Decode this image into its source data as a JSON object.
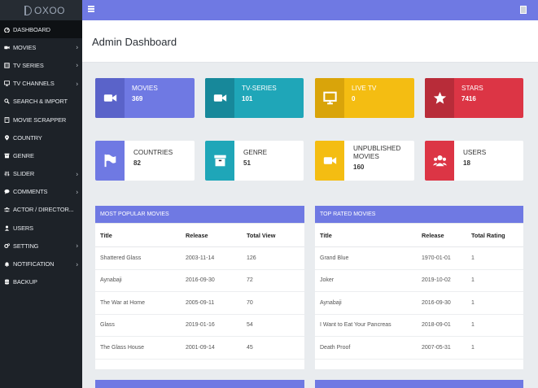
{
  "app": {
    "logo_text": "OXOO"
  },
  "sidebar": {
    "items": [
      {
        "label": "DASHBOARD",
        "icon": "dashboard-icon",
        "caret": false,
        "active": true
      },
      {
        "label": "MOVIES",
        "icon": "video-camera-icon",
        "caret": true,
        "active": false
      },
      {
        "label": "TV SERIES",
        "icon": "film-icon",
        "caret": true,
        "active": false
      },
      {
        "label": "TV CHANNELS",
        "icon": "monitor-icon",
        "caret": true,
        "active": false
      },
      {
        "label": "SEARCH & IMPORT",
        "icon": "search-icon",
        "caret": false,
        "active": false
      },
      {
        "label": "MOVIE SCRAPPER",
        "icon": "document-icon",
        "caret": false,
        "active": false
      },
      {
        "label": "COUNTRY",
        "icon": "map-marker-icon",
        "caret": false,
        "active": false
      },
      {
        "label": "GENRE",
        "icon": "archive-icon",
        "caret": false,
        "active": false
      },
      {
        "label": "SLIDER",
        "icon": "sliders-icon",
        "caret": true,
        "active": false
      },
      {
        "label": "COMMENTS",
        "icon": "comment-icon",
        "caret": true,
        "active": false
      },
      {
        "label": "ACTOR / DIRECTOR...",
        "icon": "users-group-icon",
        "caret": false,
        "active": false
      },
      {
        "label": "USERS",
        "icon": "user-icon",
        "caret": false,
        "active": false
      },
      {
        "label": "SETTING",
        "icon": "gears-icon",
        "caret": true,
        "active": false
      },
      {
        "label": "NOTIFICATION",
        "icon": "bell-icon",
        "caret": true,
        "active": false
      },
      {
        "label": "BACKUP",
        "icon": "database-icon",
        "caret": false,
        "active": false
      }
    ]
  },
  "header": {
    "title": "Admin Dashboard"
  },
  "stats_row1": [
    {
      "label": "MOVIES",
      "value": "369",
      "icon": "video-camera-icon",
      "color": "#6f79e3",
      "icon_bg": "#5a63c9"
    },
    {
      "label": "TV-SERIES",
      "value": "101",
      "icon": "video-camera-icon",
      "color": "#1fa6b8",
      "icon_bg": "#17889a"
    },
    {
      "label": "LIVE TV",
      "value": "0",
      "icon": "monitor-icon",
      "color": "#f4bd12",
      "icon_bg": "#d9a40a"
    },
    {
      "label": "STARS",
      "value": "7416",
      "icon": "star-icon",
      "color": "#dc3545",
      "icon_bg": "#b82c39"
    }
  ],
  "stats_row2": [
    {
      "label": "COUNTRIES",
      "value": "82",
      "icon": "flag-icon",
      "color": "#6f79e3"
    },
    {
      "label": "GENRE",
      "value": "51",
      "icon": "archive-icon",
      "color": "#1fa6b8"
    },
    {
      "label": "UNPUBLISHED MOVIES",
      "value": "160",
      "icon": "video-camera-icon",
      "color": "#f4bd12"
    },
    {
      "label": "USERS",
      "value": "18",
      "icon": "users-group-icon",
      "color": "#dc3545"
    }
  ],
  "popular": {
    "title": "MOST POPULAR MOVIES",
    "columns": [
      "Title",
      "Release",
      "Total View"
    ],
    "rows": [
      [
        "Shattered Glass",
        "2003-11-14",
        "126"
      ],
      [
        "Aynabaji",
        "2016-09-30",
        "72"
      ],
      [
        "The War at Home",
        "2005-09-11",
        "70"
      ],
      [
        "Glass",
        "2019-01-16",
        "54"
      ],
      [
        "The Glass House",
        "2001-09-14",
        "45"
      ]
    ]
  },
  "top_rated": {
    "title": "TOP RATED MOVIES",
    "columns": [
      "Title",
      "Release",
      "Total Rating"
    ],
    "rows": [
      [
        "Grand Blue",
        "1970-01-01",
        "1"
      ],
      [
        "Joker",
        "2019-10-02",
        "1"
      ],
      [
        "Aynabaji",
        "2016-09-30",
        "1"
      ],
      [
        "I Want to Eat Your Pancreas",
        "2018-09-01",
        "1"
      ],
      [
        "Death Proof",
        "2007-05-31",
        "1"
      ]
    ]
  }
}
